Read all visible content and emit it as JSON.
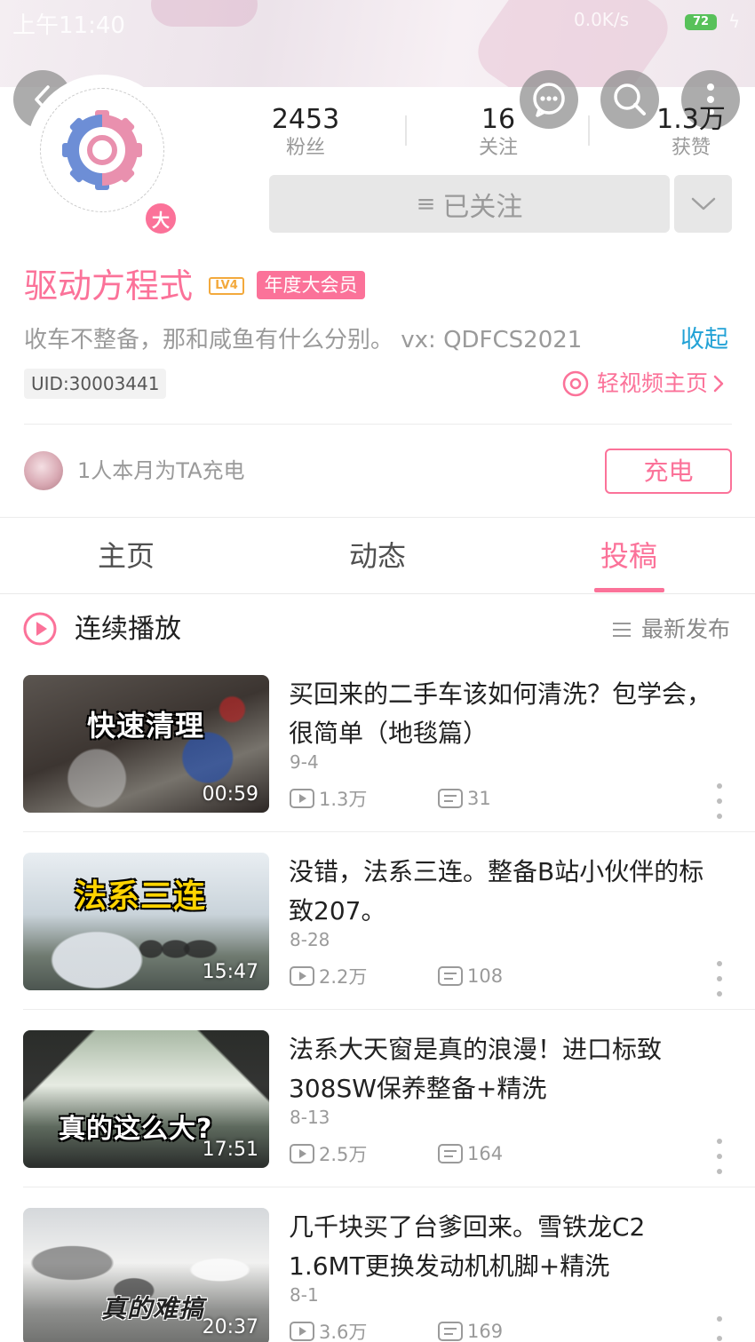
{
  "status_bar": {
    "time": "上午11:40",
    "speed": "0.0K/s",
    "battery": "72"
  },
  "profile": {
    "stats": [
      {
        "value": "2453",
        "label": "粉丝"
      },
      {
        "value": "16",
        "label": "关注"
      },
      {
        "value": "1.3万",
        "label": "获赞"
      }
    ],
    "vip_badge": "大",
    "follow_button": "已关注",
    "username": "驱动方程式",
    "level": "LV4",
    "vip_tag": "年度大会员",
    "bio": "收车不整备，那和咸鱼有什么分别。 vx: QDFCS2021",
    "collapse": "收起",
    "uid": "UID:30003441",
    "light_video_home": "轻视频主页"
  },
  "charge": {
    "text": "1人本月为TA充电",
    "button": "充电"
  },
  "tabs": [
    {
      "label": "主页"
    },
    {
      "label": "动态"
    },
    {
      "label": "投稿"
    }
  ],
  "toolbar": {
    "continuous_play": "连续播放",
    "sort": "最新发布"
  },
  "videos": [
    {
      "title": "买回来的二手车该如何清洗？包学会，很简单（地毯篇）",
      "thumb_caption": "快速清理",
      "duration": "00:59",
      "date": "9-4",
      "views": "1.3万",
      "comments": "31"
    },
    {
      "title": "没错，法系三连。整备B站小伙伴的标致207。",
      "thumb_caption": "法系三连",
      "duration": "15:47",
      "date": "8-28",
      "views": "2.2万",
      "comments": "108"
    },
    {
      "title": "法系大天窗是真的浪漫！进口标致308SW保养整备+精洗",
      "thumb_caption": "真的这么大?",
      "duration": "17:51",
      "date": "8-13",
      "views": "2.5万",
      "comments": "164"
    },
    {
      "title": "几千块买了台爹回来。雪铁龙C2 1.6MT更换发动机机脚+精洗",
      "thumb_caption": "真的难搞",
      "duration": "20:37",
      "date": "8-1",
      "views": "3.6万",
      "comments": "169"
    }
  ],
  "colors": {
    "accent": "#fb7299",
    "link": "#23a2d6",
    "level": "#f3a93c"
  }
}
